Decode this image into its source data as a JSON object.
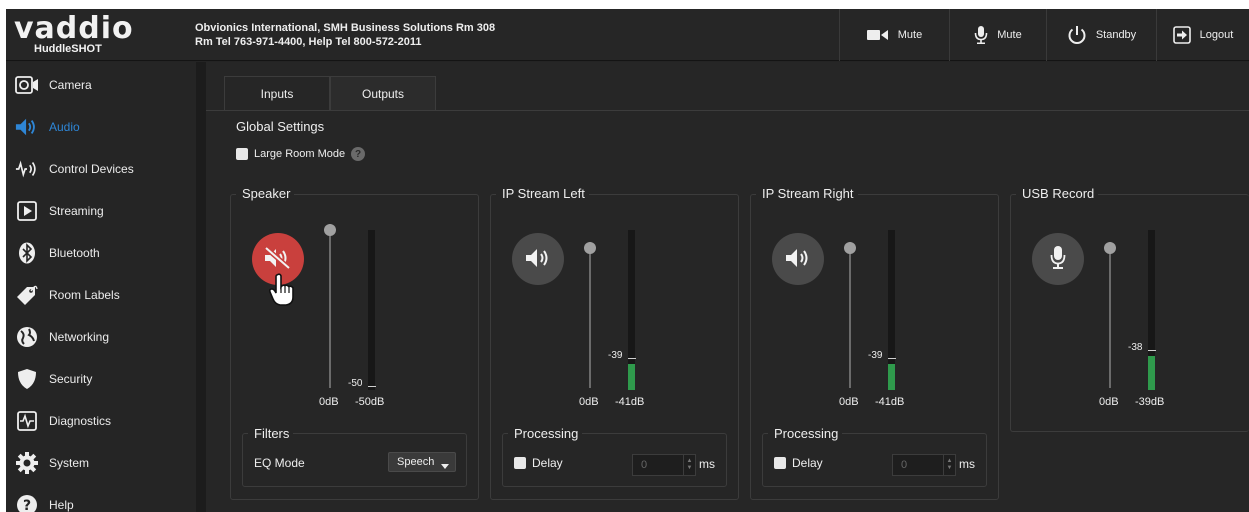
{
  "header": {
    "brand": "vaddio",
    "product": "HuddleSHOT",
    "site_line1": "Obvionics International, SMH Business Solutions Rm 308",
    "site_line2": "Rm Tel 763-971-4400, Help Tel 800-572-2011",
    "buttons": {
      "video_mute": "Mute",
      "audio_mute": "Mute",
      "standby": "Standby",
      "logout": "Logout"
    }
  },
  "sidebar": {
    "items": [
      {
        "label": "Camera",
        "icon": "camera-icon"
      },
      {
        "label": "Audio",
        "icon": "speaker-icon",
        "active": true
      },
      {
        "label": "Control Devices",
        "icon": "control-devices-icon"
      },
      {
        "label": "Streaming",
        "icon": "play-icon"
      },
      {
        "label": "Bluetooth",
        "icon": "bluetooth-icon"
      },
      {
        "label": "Room Labels",
        "icon": "tag-icon"
      },
      {
        "label": "Networking",
        "icon": "globe-icon"
      },
      {
        "label": "Security",
        "icon": "shield-icon"
      },
      {
        "label": "Diagnostics",
        "icon": "pulse-icon"
      },
      {
        "label": "System",
        "icon": "gear-icon"
      },
      {
        "label": "Help",
        "icon": "help-icon"
      }
    ]
  },
  "tabs": [
    {
      "label": "Inputs",
      "active": false
    },
    {
      "label": "Outputs",
      "active": true
    }
  ],
  "global": {
    "title": "Global Settings",
    "large_room_label": "Large Room Mode",
    "large_room_checked": false,
    "help_glyph": "?"
  },
  "channels": [
    {
      "title": "Speaker",
      "button_icon": "speaker-muted-icon",
      "muted": true,
      "slider_label": "0dB",
      "meter_label": "-50dB",
      "meter_marker": "-50",
      "meter_level": 0.0,
      "section": {
        "title": "Filters",
        "eq_label": "EQ Mode",
        "eq_value": "Speech"
      }
    },
    {
      "title": "IP Stream Left",
      "button_icon": "speaker-icon",
      "muted": false,
      "slider_label": "0dB",
      "meter_label": "-41dB",
      "meter_marker": "-39",
      "meter_level": 0.16,
      "section": {
        "title": "Processing",
        "delay_label": "Delay",
        "delay_value": "0",
        "unit": "ms"
      }
    },
    {
      "title": "IP Stream Right",
      "button_icon": "speaker-icon",
      "muted": false,
      "slider_label": "0dB",
      "meter_label": "-41dB",
      "meter_marker": "-39",
      "meter_level": 0.16,
      "section": {
        "title": "Processing",
        "delay_label": "Delay",
        "delay_value": "0",
        "unit": "ms"
      }
    },
    {
      "title": "USB Record",
      "button_icon": "microphone-icon",
      "muted": false,
      "slider_label": "0dB",
      "meter_label": "-39dB",
      "meter_marker": "-38",
      "meter_level": 0.21
    }
  ],
  "colors": {
    "accent": "#2e86d6",
    "mute_red": "#c9403d",
    "meter_green": "#2f9a4c"
  }
}
